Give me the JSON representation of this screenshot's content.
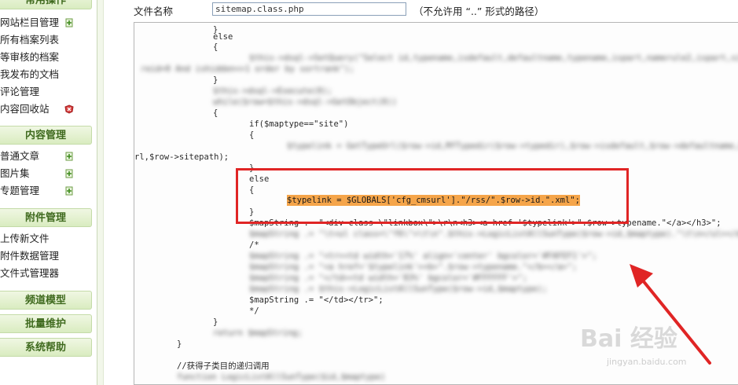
{
  "sidebar": {
    "top_section": "常用操作",
    "top_items": [
      {
        "label": "网站栏目管理",
        "icon": "add-icon"
      },
      {
        "label": "所有档案列表"
      },
      {
        "label": "等审核的档案"
      },
      {
        "label": "我发布的文档"
      },
      {
        "label": "评论管理"
      },
      {
        "label": "内容回收站",
        "icon": "recycle-delete-icon"
      }
    ],
    "content_section": "内容管理",
    "content_items": [
      {
        "label": "普通文章",
        "icon": "add-icon"
      },
      {
        "label": "图片集",
        "icon": "add-icon"
      },
      {
        "label": "专题管理",
        "icon": "add-icon"
      }
    ],
    "attach_section": "附件管理",
    "attach_items": [
      {
        "label": "上传新文件"
      },
      {
        "label": "附件数据管理"
      },
      {
        "label": "文件式管理器"
      }
    ],
    "channel_section": "频道模型",
    "batch_section": "批量维护",
    "help_section": "系统帮助"
  },
  "file": {
    "label": "文件名称",
    "value": "sitemap.class.php",
    "note": "（不允许用 “..” 形式的路径）"
  },
  "code_lines": {
    "l01": "}",
    "l02": "else",
    "l03": "{",
    "l04": "$this->dsql->SetQuery(\"Select id,typename,isdefault,defaultname,typename,ispart,namerule2,ispart,sitepat",
    "l05": "reid=0 And ishidden<>1 order by sortrank\");",
    "l06": "}",
    "l07": "$this->dsql->Execute(0);",
    "l08": "while($row=$this->dsql->GetObject(0))",
    "l09": "{",
    "l10": "if($maptype==\"site\")",
    "l11": "{",
    "l12": "$typelink = GetTypeUrl($row->id,MfTypedir($row->typedir),$row->isdefault,$row->defaultname,$row->ispart,$row->namerule2,$row->siteu",
    "l13": "rl,$row->sitepath);",
    "l14": "}",
    "l15": "else",
    "l16": "{",
    "l17": "$typelink = $GLOBALS['cfg_cmsurl'].\"/rss/\".$row->id.\".xml\";",
    "l18": "}",
    "l19": "$mapString .= \"<div class=\\\"linkbox\\\">\\r\\n<h3><a href='$typelink'>\".$row->typename.\"</a></h3>\";",
    "l20": "$mapString .= \"\\t<ul class=\\\"f6\\\">\\t\\n\".$this->LogicListAllSunType($row->id,$maptype).\"\\t\\n</ul></div>",
    "l21": "/*",
    "l22": "$mapString .= \"<tr><td width='17%' align='center' bgcolor='#FAFEF1'>\";",
    "l23": "$mapString .= \"<a href='$typelink'><b>\".$row->typename.\"</b></a>\";",
    "l24": "$mapString .= \"</td><td width='83%' bgcolor='#FFFFFF'>\";",
    "l25": "$mapString .= $this->LogicListAllSunType($row->id,$maptype);",
    "l26": "$mapString .= \"</td></tr>\";",
    "l27": "*/",
    "l28": "}",
    "l29": "return $mapString;",
    "l30": "}",
    "l31": "//获得子类目的递归调用",
    "l32": "function LogicListAllSunType($id,$maptype)"
  },
  "watermark": {
    "brand": "Bai 经验",
    "site": "jingyan.baidu.com"
  },
  "colors": {
    "highlight": "#f5a54a",
    "annotation_red": "#e02525",
    "section_green": "#3f6a1e"
  }
}
